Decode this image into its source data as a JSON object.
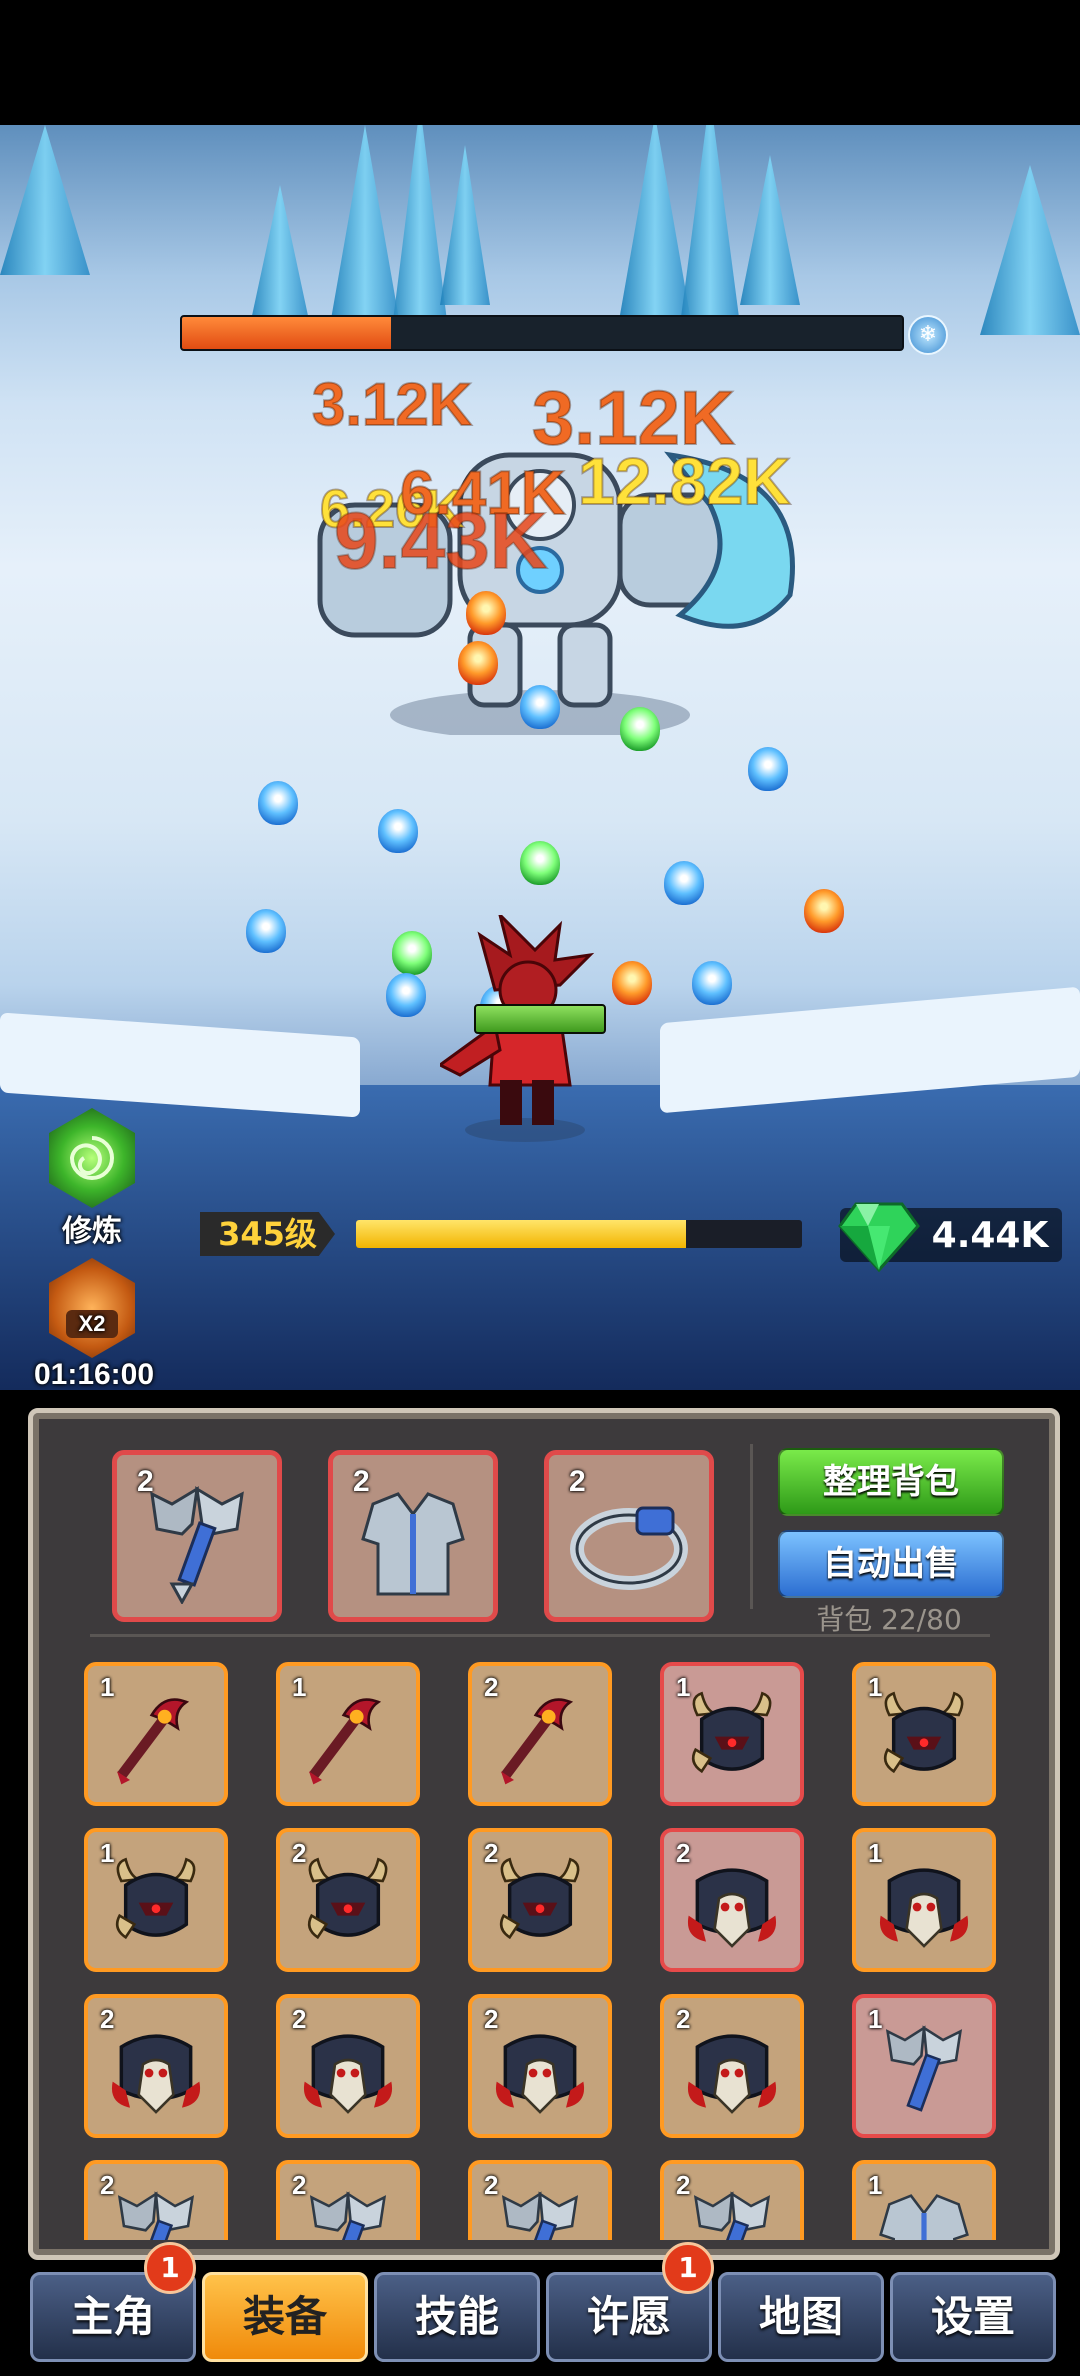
{
  "boss": {
    "hp_fraction": 0.29
  },
  "damage_numbers": [
    {
      "text": "3.12K",
      "color": "#f06a24"
    },
    {
      "text": "3.12K",
      "color": "#f06a24"
    },
    {
      "text": "12.82K",
      "color": "#ffe13a"
    },
    {
      "text": "6.26K",
      "color": "#ffe13a"
    },
    {
      "text": "6.41K",
      "color": "#f06a24"
    },
    {
      "text": "9.43K",
      "color": "#e8471a"
    }
  ],
  "hero": {
    "hp_fraction": 1.0
  },
  "skills": {
    "cultivate_label": "修炼",
    "double_label": "X2",
    "double_timer": "01:16:00"
  },
  "status": {
    "level_label": "345级",
    "xp_fraction": 0.74,
    "gems": "4.44K"
  },
  "inventory": {
    "equipped": [
      {
        "count": "2",
        "icon": "axe-icon"
      },
      {
        "count": "2",
        "icon": "armor-icon"
      },
      {
        "count": "2",
        "icon": "ring-icon"
      }
    ],
    "sort_label": "整理背包",
    "autosell_label": "自动出售",
    "capacity": "背包 22/80",
    "items": [
      {
        "count": "1",
        "icon": "staff-icon",
        "rarity": "orange"
      },
      {
        "count": "1",
        "icon": "staff-icon",
        "rarity": "orange"
      },
      {
        "count": "2",
        "icon": "staff-icon",
        "rarity": "orange"
      },
      {
        "count": "1",
        "icon": "horned-helmet-icon",
        "rarity": "red"
      },
      {
        "count": "1",
        "icon": "horned-helmet-icon",
        "rarity": "orange"
      },
      {
        "count": "1",
        "icon": "horned-helmet-icon",
        "rarity": "orange"
      },
      {
        "count": "2",
        "icon": "horned-helmet-icon",
        "rarity": "orange"
      },
      {
        "count": "2",
        "icon": "horned-helmet-icon",
        "rarity": "orange"
      },
      {
        "count": "2",
        "icon": "skull-helmet-icon",
        "rarity": "red"
      },
      {
        "count": "1",
        "icon": "skull-helmet-icon",
        "rarity": "orange"
      },
      {
        "count": "2",
        "icon": "skull-helmet-icon",
        "rarity": "orange"
      },
      {
        "count": "2",
        "icon": "skull-helmet-icon",
        "rarity": "orange"
      },
      {
        "count": "2",
        "icon": "skull-helmet-icon",
        "rarity": "orange"
      },
      {
        "count": "2",
        "icon": "skull-helmet-icon",
        "rarity": "orange"
      },
      {
        "count": "1",
        "icon": "axe-icon",
        "rarity": "red"
      },
      {
        "count": "2",
        "icon": "axe-icon",
        "rarity": "orange"
      },
      {
        "count": "2",
        "icon": "axe-icon",
        "rarity": "orange"
      },
      {
        "count": "2",
        "icon": "axe-icon",
        "rarity": "orange"
      },
      {
        "count": "2",
        "icon": "axe-icon",
        "rarity": "orange"
      },
      {
        "count": "1",
        "icon": "armor-icon",
        "rarity": "orange"
      }
    ]
  },
  "nav": [
    {
      "label": "主角",
      "badge": "1",
      "active": false
    },
    {
      "label": "装备",
      "badge": "",
      "active": true
    },
    {
      "label": "技能",
      "badge": "",
      "active": false
    },
    {
      "label": "许愿",
      "badge": "1",
      "active": false
    },
    {
      "label": "地图",
      "badge": "",
      "active": false
    },
    {
      "label": "设置",
      "badge": "",
      "active": false
    }
  ],
  "colors": {
    "accent": "#f5a623",
    "boss_hp": "#e8541a",
    "hero_hp": "#5fc23a",
    "xp": "#f7c21a",
    "rarity_orange": "#ff9a22",
    "rarity_red": "#e64a4a"
  }
}
